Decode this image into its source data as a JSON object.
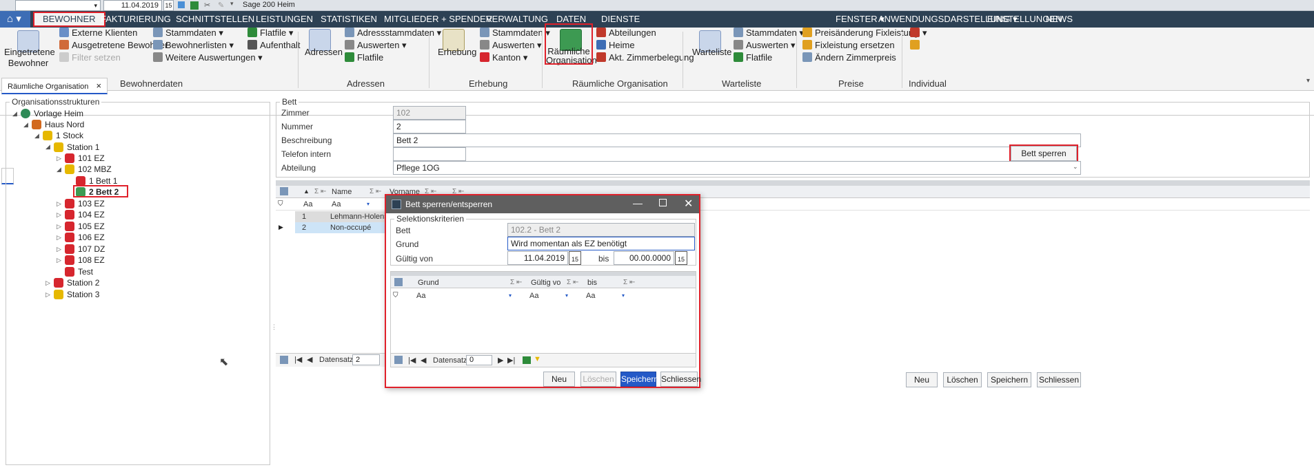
{
  "topbar": {
    "date": "11.04.2019",
    "cal_day": "15",
    "app_name": "Sage 200 Heim"
  },
  "menu": {
    "home": "⌂",
    "tabs": [
      "BEWOHNER",
      "FAKTURIERUNG",
      "SCHNITTSTELLEN",
      "LEISTUNGEN",
      "STATISTIKEN",
      "MITGLIEDER + SPENDER",
      "VERWALTUNG",
      "DATEN",
      "DIENSTE"
    ],
    "right": [
      "FENSTER",
      "ANWENDUNGSDARSTELLUNG",
      "EINSTELLUNGEN",
      "NEWS"
    ]
  },
  "ribbon": {
    "eingetretene": "Eingetretene\nBewohner",
    "externe": "Externe Klienten",
    "ausgetretene": "Ausgetretene Bewohner",
    "filter": "Filter setzen",
    "stammdaten1": "Stammdaten",
    "bewohnerlisten": "Bewohnerlisten",
    "weitere": "Weitere Auswertungen",
    "flatfile1": "Flatfile",
    "aufenthalt": "Aufenthalt",
    "group1": "Bewohnerdaten",
    "adressen_big": "Adressen",
    "adressstamm": "Adressstammdaten",
    "auswerten1": "Auswerten",
    "flatfile2": "Flatfile",
    "group2": "Adressen",
    "erhebung_big": "Erhebung",
    "stammdaten2": "Stammdaten",
    "auswerten2": "Auswerten",
    "kanton": "Kanton",
    "group3": "Erhebung",
    "raeumliche_big": "Räumliche\nOrganisation",
    "abteilungen": "Abteilungen",
    "heime": "Heime",
    "zimmerbelegung": "Akt. Zimmerbelegung",
    "group4": "Räumliche Organisation",
    "warteliste_big": "Warteliste",
    "stammdaten3": "Stammdaten",
    "auswerten3": "Auswerten",
    "flatfile3": "Flatfile",
    "group5": "Warteliste",
    "preisaenderung": "Preisänderung Fixleistung",
    "fixleistung": "Fixleistung ersetzen",
    "zimmerpreis": "Ändern Zimmerpreis",
    "group6": "Preise",
    "group7": "Individual"
  },
  "doctab": {
    "label": "Räumliche Organisation",
    "close": "×"
  },
  "tree": {
    "legend": "Organisationsstrukturen",
    "nodes": [
      {
        "label": "Vorlage Heim",
        "icon": "globe-icon"
      },
      {
        "label": "Haus Nord",
        "icon": "house-icon"
      },
      {
        "label": "1 Stock",
        "icon": "floor-icon"
      },
      {
        "label": "Station 1",
        "icon": "station-icon"
      },
      {
        "label": "101  EZ",
        "icon": "room-icon"
      },
      {
        "label": "102  MBZ",
        "icon": "room-icon"
      },
      {
        "label": "1  Bett 1",
        "icon": "bed-icon"
      },
      {
        "label": "2  Bett 2",
        "icon": "bed-icon"
      },
      {
        "label": "103  EZ",
        "icon": "room-icon"
      },
      {
        "label": "104  EZ",
        "icon": "room-icon"
      },
      {
        "label": "105  EZ",
        "icon": "room-icon"
      },
      {
        "label": "106  EZ",
        "icon": "room-icon"
      },
      {
        "label": "107  DZ",
        "icon": "room-icon"
      },
      {
        "label": "108  EZ",
        "icon": "room-icon"
      },
      {
        "label": "Test",
        "icon": "room-icon"
      },
      {
        "label": "Station 2",
        "icon": "station-icon"
      },
      {
        "label": "Station 3",
        "icon": "station-icon"
      }
    ]
  },
  "bett": {
    "legend": "Bett",
    "zimmer_label": "Zimmer",
    "zimmer": "102",
    "nummer_label": "Nummer",
    "nummer": "2",
    "beschreibung_label": "Beschreibung",
    "beschreibung": "Bett 2",
    "telefon_label": "Telefon intern",
    "telefon": "",
    "abteilung_label": "Abteilung",
    "abteilung": "Pflege 1OG",
    "sperren_btn": "Bett sperren"
  },
  "grid": {
    "col_name": "Name",
    "col_vorname": "Vorname",
    "filter_aa": "Aa",
    "rows": [
      {
        "num": "1",
        "name": "Lehmann-Holenste"
      },
      {
        "num": "2",
        "name": "Non-occupé"
      }
    ],
    "datensatz_label": "Datensatz",
    "datensatz": "2"
  },
  "bottom": {
    "neu": "Neu",
    "loeschen": "Löschen",
    "speichern": "Speichern",
    "schliessen": "Schliessen"
  },
  "dialog": {
    "title": "Bett sperren/entsperren",
    "legend": "Selektionskriterien",
    "bett_label": "Bett",
    "bett": "102.2 - Bett 2",
    "grund_label": "Grund",
    "grund": "Wird momentan als EZ benötigt",
    "gueltig_label": "Gültig von",
    "gueltig_von": "11.04.2019",
    "bis_label": "bis",
    "bis": "00.00.0000",
    "cal_day": "15",
    "cols": [
      "Grund",
      "Gültig vo",
      "bis"
    ],
    "filter_aa": "Aa",
    "datensatz_label": "Datensatz",
    "datensatz": "0",
    "neu": "Neu",
    "loeschen": "Löschen",
    "speichern": "Speichern",
    "schliessen": "Schliessen"
  }
}
